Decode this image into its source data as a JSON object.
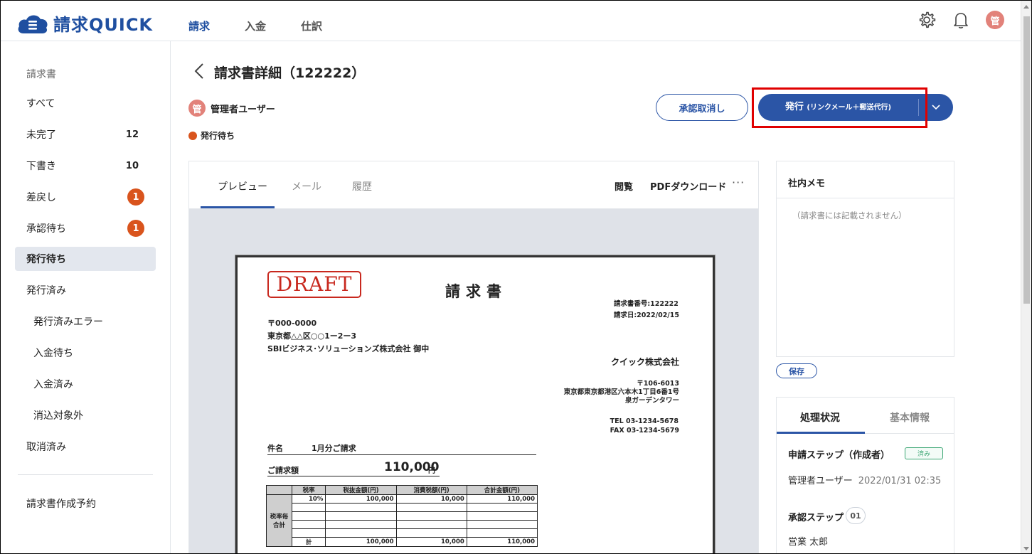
{
  "header": {
    "logo_text": "請求QUICK",
    "nav": [
      "請求",
      "入金",
      "仕訳"
    ],
    "avatar": "管"
  },
  "sidebar": {
    "section": "請求書",
    "items": [
      {
        "label": "すべて"
      },
      {
        "label": "未完了",
        "count": "12"
      },
      {
        "label": "下書き",
        "count": "10"
      },
      {
        "label": "差戻し",
        "badge": "1"
      },
      {
        "label": "承認待ち",
        "badge": "1"
      },
      {
        "label": "発行待ち"
      },
      {
        "label": "発行済み"
      },
      {
        "label": "発行済みエラー"
      },
      {
        "label": "入金待ち"
      },
      {
        "label": "入金済み"
      },
      {
        "label": "消込対象外"
      },
      {
        "label": "取消済み"
      }
    ],
    "reservation": "請求書作成予約"
  },
  "main": {
    "title": "請求書詳細（122222）",
    "user_name": "管理者ユーザー",
    "user_avatar": "管",
    "status": "発行待ち",
    "cancel_approval": "承認取消し",
    "issue_button": "発行",
    "issue_button_note": "(リンクメール＋郵送代行)"
  },
  "preview": {
    "tabs": [
      "プレビュー",
      "メール",
      "履歴"
    ],
    "view": "閲覧",
    "pdf_download": "PDFダウンロード",
    "more": "···"
  },
  "invoice": {
    "stamp": "DRAFT",
    "title": "請求書",
    "number_line": "請求書番号:122222",
    "date_line": "請求日:2022/02/15",
    "to_zip": "〒000-0000",
    "to_address": "東京都△△区○○1ー2ー3",
    "to_name": "SBIビジネス･ソリューションズ株式会社  御中",
    "company": "クイック株式会社",
    "company_zip": "〒106-6013",
    "company_address": "東京都東京都港区六本木1丁目6番1号",
    "company_building": "泉ガーデンタワー",
    "tel": "TEL 03-1234-5678",
    "fax": "FAX 03-1234-5679",
    "subject_label": "件名",
    "subject_value": "1月分ご請求",
    "amount_label": "ご請求額",
    "amount_value": "110,000",
    "amount_unit": "円",
    "table_headers": [
      "税率",
      "税抜金額(円)",
      "消費税額(円)",
      "合計金額(円)"
    ],
    "table_row_header": "税率毎合計",
    "rows": [
      [
        "10%",
        "100,000",
        "10,000",
        "110,000"
      ],
      [
        "",
        "",
        "",
        ""
      ],
      [
        "",
        "",
        "",
        ""
      ],
      [
        "",
        "",
        "",
        ""
      ],
      [
        "",
        "",
        "",
        ""
      ]
    ],
    "total_row": [
      "計",
      "100,000",
      "10,000",
      "110,000"
    ]
  },
  "memo": {
    "title": "社内メモ",
    "placeholder": "（請求書には記載されません）",
    "save": "保存"
  },
  "status_panel": {
    "tabs": [
      "処理状況",
      "基本情報"
    ],
    "step1_title": "申請ステップ（作成者）",
    "step1_badge": "済み",
    "step1_user": "管理者ユーザー",
    "step1_date": "2022/01/31 02:35",
    "step2_title": "承認ステップ",
    "step2_num": "01",
    "step2_user": "営業 太郎"
  },
  "colors": {
    "brand": "#1f4fa0",
    "accent": "#2b55a6",
    "badge": "#d9541d",
    "highlight": "#e00000"
  }
}
